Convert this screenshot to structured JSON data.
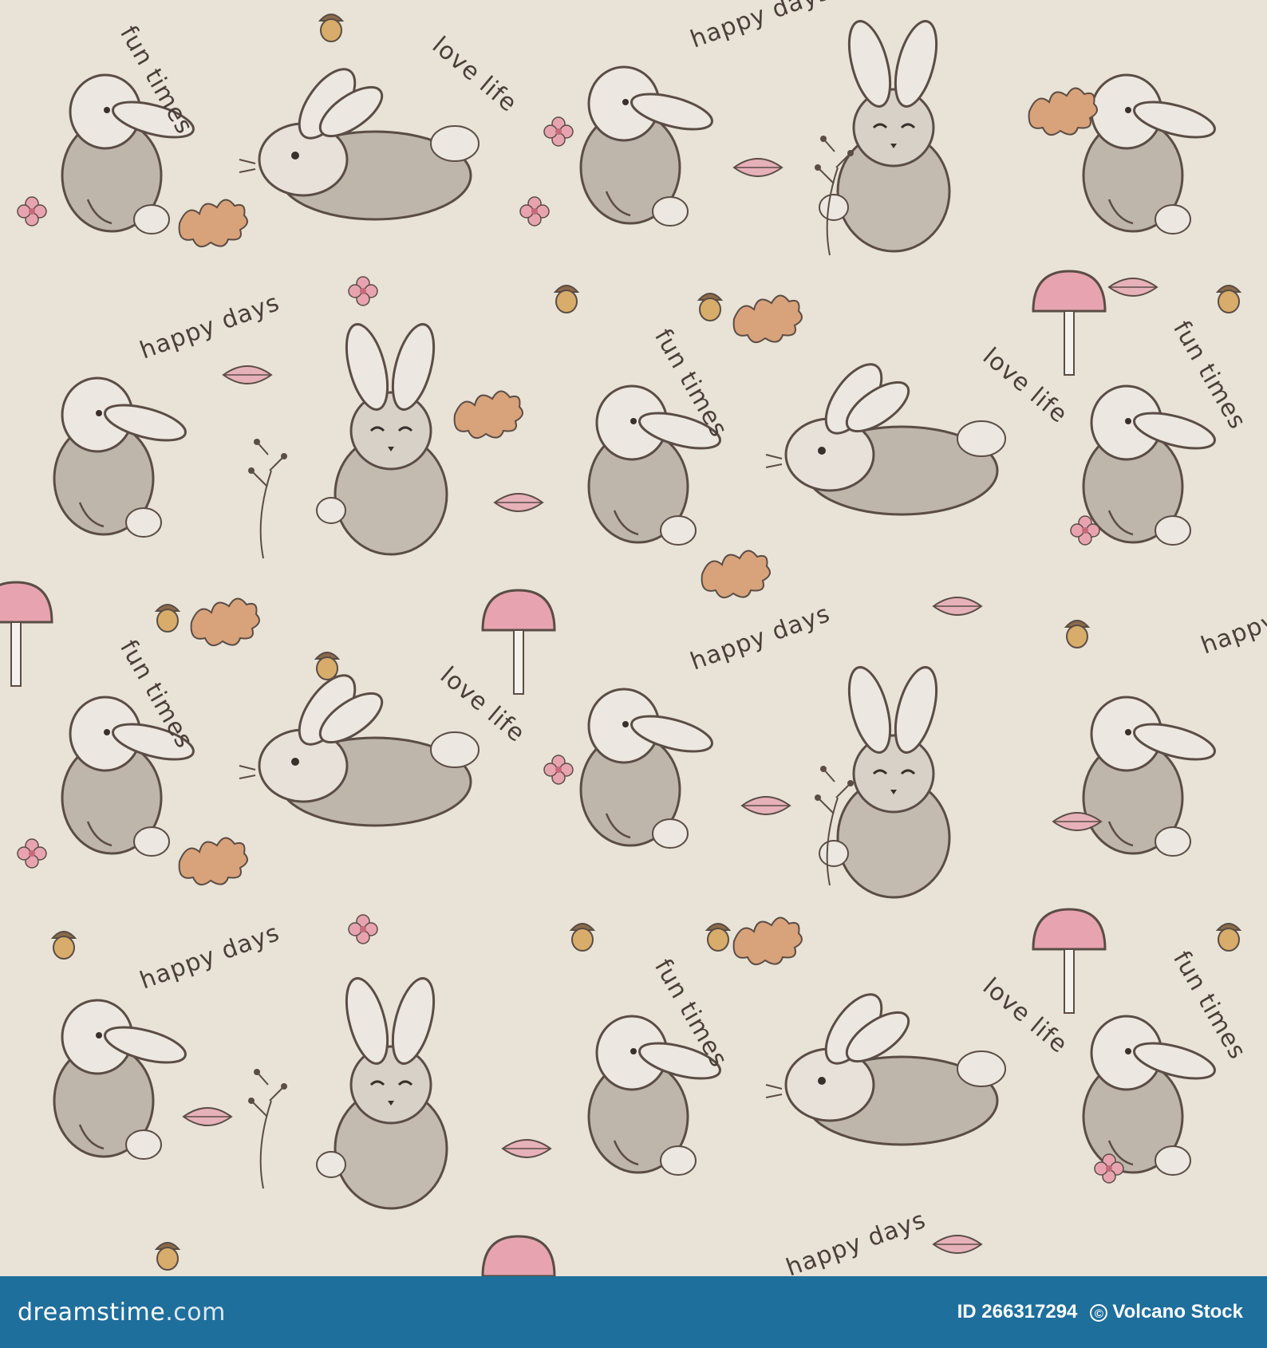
{
  "pattern": {
    "slogans": [
      "fun times",
      "love life",
      "happy days"
    ],
    "motifs": [
      "bunny-icon",
      "leaf-icon",
      "acorn-icon",
      "mushroom-icon",
      "flower-icon",
      "berry-sprig-icon"
    ],
    "colors": {
      "background": "#e9e2d6",
      "fur": "#bfb6ab",
      "fur_light": "#ebe6df",
      "outline": "#5a4d45",
      "pink": "#e7a4b0",
      "leaf_orange": "#d29b6c",
      "acorn": "#c99a57"
    }
  },
  "footer": {
    "logo": "dreamstime",
    "logo_tld": ".com",
    "id_text": "ID 266317294",
    "credit": "Volcano Stock",
    "colors": {
      "bar": "#1f6f9c",
      "text": "#ffffff"
    }
  }
}
